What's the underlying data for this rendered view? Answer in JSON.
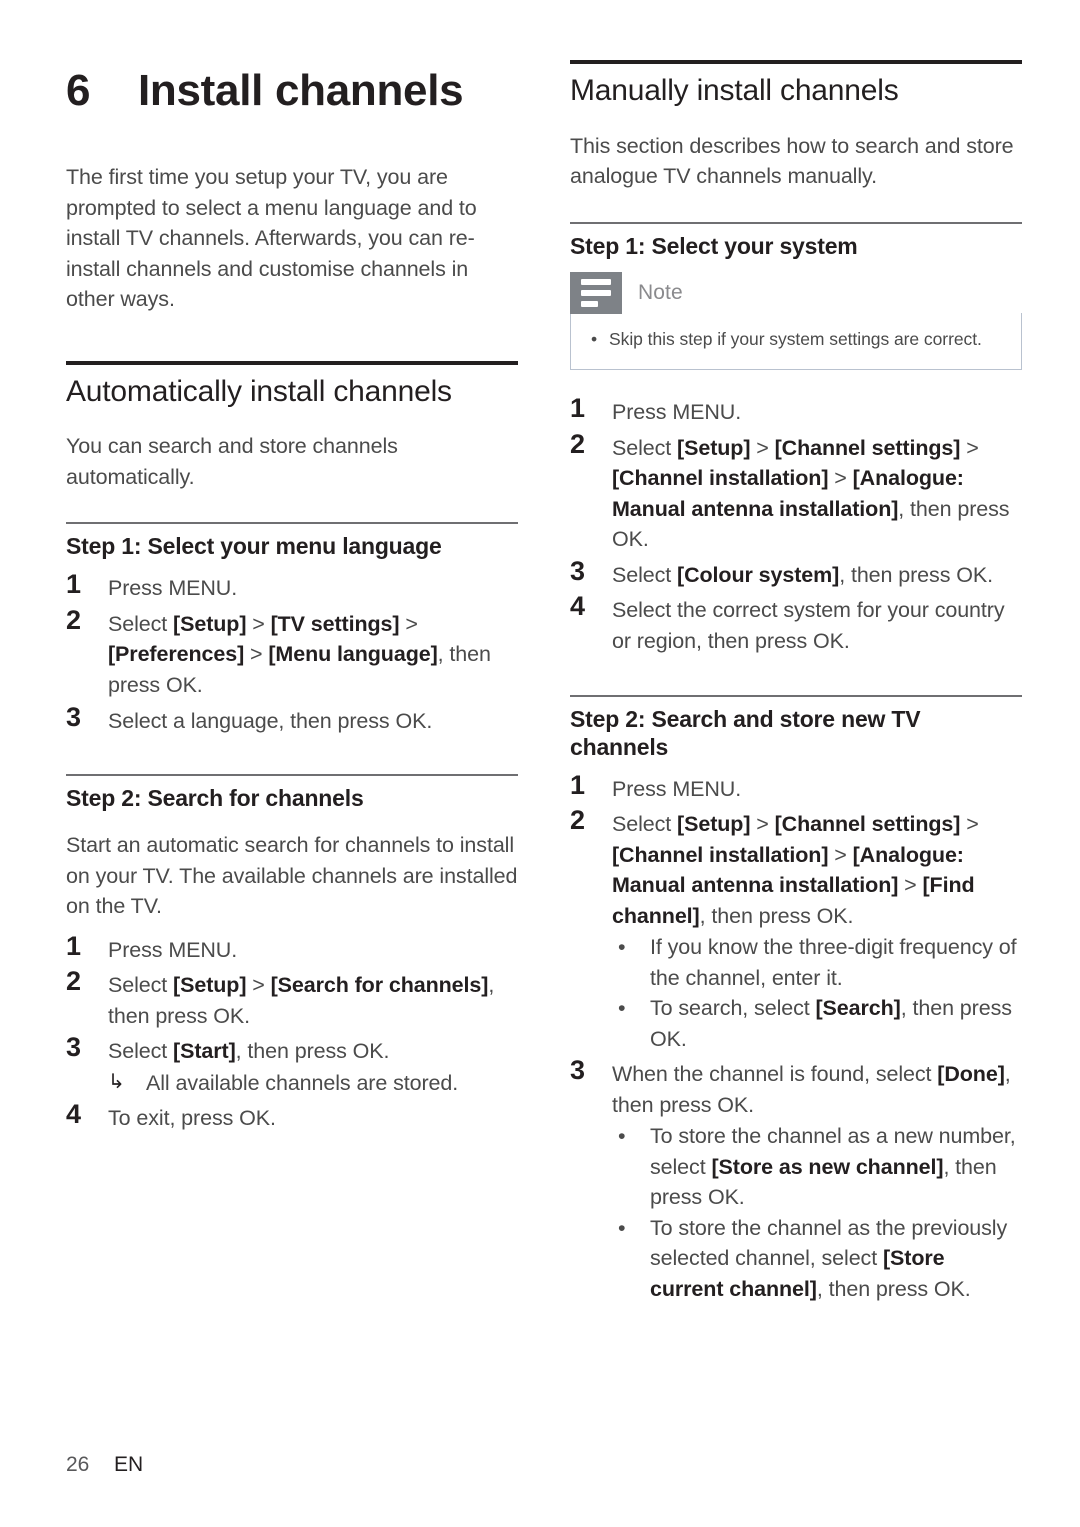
{
  "chapter": {
    "number": "6",
    "title": "Install channels",
    "intro": "The first time you setup your TV, you are prompted to select a menu language and to install TV channels. Afterwards, you can re-install channels and customise channels in other ways."
  },
  "left": {
    "section_title": "Automatically install channels",
    "section_intro": "You can search and store channels automatically.",
    "step1": {
      "heading": "Step 1: Select your menu language",
      "items": [
        {
          "num": "1",
          "text": "Press MENU."
        },
        {
          "num": "2",
          "text": "Select [Setup] > [TV settings] > [Preferences] > [Menu language], then press OK."
        },
        {
          "num": "3",
          "text": "Select a language, then press OK."
        }
      ]
    },
    "step2": {
      "heading": "Step 2: Search for channels",
      "intro": "Start an automatic search for channels to install on your TV. The available channels are installed on the TV.",
      "items": [
        {
          "num": "1",
          "text": "Press MENU."
        },
        {
          "num": "2",
          "text": "Select [Setup] > [Search for channels], then press OK."
        },
        {
          "num": "3",
          "text": "Select [Start], then press OK."
        },
        {
          "num": "4",
          "text": "To exit, press OK."
        }
      ],
      "result_arrow": "↳",
      "result_text": "All available channels are stored."
    }
  },
  "right": {
    "section_title": "Manually install channels",
    "section_intro": "This section describes how to search and store analogue TV channels manually.",
    "step1": {
      "heading": "Step 1: Select your system",
      "note": {
        "title": "Note",
        "bullet_glyph": "•",
        "items": [
          "Skip this step if your system settings are correct."
        ]
      },
      "items": [
        {
          "num": "1",
          "text": "Press MENU."
        },
        {
          "num": "2",
          "text": "Select [Setup] > [Channel settings] > [Channel installation] > [Analogue: Manual antenna installation], then press OK."
        },
        {
          "num": "3",
          "text": "Select [Colour system], then press OK."
        },
        {
          "num": "4",
          "text": "Select the correct system for your country or region, then press OK."
        }
      ]
    },
    "step2": {
      "heading": "Step 2: Search and store new TV channels",
      "bullet_glyph": "•",
      "items": [
        {
          "num": "1",
          "text": "Press MENU."
        },
        {
          "num": "2",
          "text": "Select [Setup] > [Channel settings] > [Channel installation] > [Analogue: Manual antenna installation] > [Find channel], then press OK."
        },
        {
          "num": "3",
          "text": "When the channel is found, select [Done], then press OK."
        }
      ],
      "item2_bullets": [
        "If you know the three-digit frequency of the channel, enter it.",
        "To search, select [Search], then press OK."
      ],
      "item3_bullets": [
        "To store the channel as a new number, select [Store as new channel], then press OK.",
        "To store the channel as the previously selected channel, select [Store current channel], then press OK."
      ]
    }
  },
  "footer": {
    "page_number": "26",
    "language": "EN"
  },
  "colors": {
    "heading": "#231f20",
    "body_text": "#4b4b4b",
    "rule_thick": "#231f20",
    "rule_thin": "#6f6f72",
    "note_icon_bg": "#7e8287",
    "note_border": "#b9c2cf",
    "note_title": "#8a8a8d"
  }
}
